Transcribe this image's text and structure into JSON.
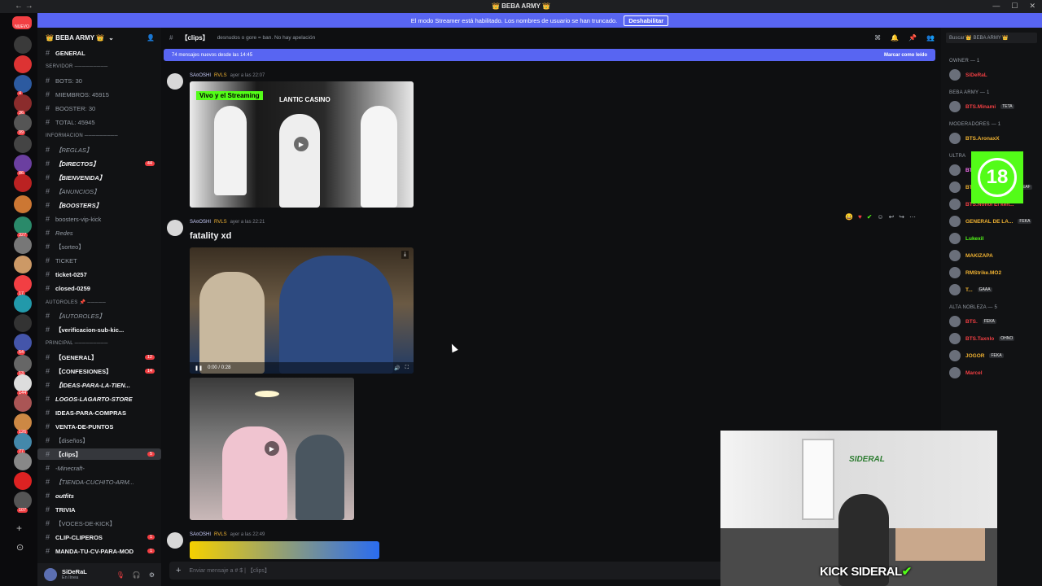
{
  "window": {
    "title": "👑 BEBA ARMY 👑",
    "controls": [
      "—",
      "☐",
      "✕"
    ]
  },
  "streamer_banner": {
    "text": "El modo Streamer está habilitado. Los nombres de usuario se han truncado.",
    "button": "Deshabilitar"
  },
  "server_badge_new": "NUEVO",
  "server_list": {
    "badges": [
      "4",
      "36",
      "99",
      "86",
      "327",
      "17",
      "54",
      "13",
      "144",
      "126",
      "77",
      "107"
    ]
  },
  "server": {
    "name": "👑 BEBA ARMY 👑"
  },
  "channels": [
    {
      "type": "channel",
      "label": "GENERAL",
      "strong": true
    },
    {
      "type": "category",
      "label": "SERVIDOR ─────────"
    },
    {
      "type": "channel",
      "label": "BOTS: 30"
    },
    {
      "type": "channel",
      "label": "MIEMBROS: 45915"
    },
    {
      "type": "channel",
      "label": "BOOSTER: 30"
    },
    {
      "type": "channel",
      "label": "TOTAL: 45945"
    },
    {
      "type": "category",
      "label": "INFORMACION ─────────"
    },
    {
      "type": "channel",
      "label": "【REGLAS】",
      "italic": true
    },
    {
      "type": "channel",
      "label": "【DIRECTOS】",
      "italic": true,
      "strong": true,
      "badge": "44"
    },
    {
      "type": "channel",
      "label": "【BIENVENIDA】",
      "italic": true,
      "strong": true
    },
    {
      "type": "channel",
      "label": "【ANUNCIOS】",
      "italic": true
    },
    {
      "type": "channel",
      "label": "【BOOSTERS】",
      "italic": true,
      "strong": true
    },
    {
      "type": "channel",
      "label": "boosters-vip-kick"
    },
    {
      "type": "channel",
      "label": "Redes",
      "italic": true
    },
    {
      "type": "channel",
      "label": "【sorteo】"
    },
    {
      "type": "channel",
      "label": "TICKET"
    },
    {
      "type": "channel",
      "label": "ticket-0257",
      "strong": true
    },
    {
      "type": "channel",
      "label": "closed-0259",
      "strong": true
    },
    {
      "type": "category",
      "label": "AUTOROLES 📌 ─────"
    },
    {
      "type": "channel",
      "label": "【AUTOROLES】",
      "italic": true
    },
    {
      "type": "channel",
      "label": "【verificacion-sub-kic...",
      "strong": true
    },
    {
      "type": "category",
      "label": "PRINCIPAL ─────────"
    },
    {
      "type": "channel",
      "label": "【GENERAL】",
      "strong": true,
      "badge": "12"
    },
    {
      "type": "channel",
      "label": "【CONFESIONES】",
      "strong": true,
      "badge": "14"
    },
    {
      "type": "channel",
      "label": "【IDEAS-PARA-LA-TIEN...",
      "italic": true,
      "strong": true
    },
    {
      "type": "channel",
      "label": "LOGOS-LAGARTO-STORE",
      "italic": true,
      "strong": true
    },
    {
      "type": "channel",
      "label": "IDEAS-PARA-COMPRAS",
      "strong": true
    },
    {
      "type": "channel",
      "label": "VENTA-DE-PUNTOS",
      "strong": true
    },
    {
      "type": "channel",
      "label": "【diseños】"
    },
    {
      "type": "channel",
      "label": "【clips】",
      "strong": true,
      "active": true,
      "badge": "5"
    },
    {
      "type": "channel",
      "label": "-Minecraft-",
      "italic": true
    },
    {
      "type": "channel",
      "label": "【TIENDA-CUCHITO-ARM...",
      "italic": true
    },
    {
      "type": "channel",
      "label": "outfits",
      "italic": true,
      "strong": true
    },
    {
      "type": "channel",
      "label": "TRIVIA",
      "strong": true
    },
    {
      "type": "channel",
      "label": "【VOCES-DE-KICK】"
    },
    {
      "type": "channel",
      "label": "CLIP-CLIPEROS",
      "strong": true,
      "badge": "1"
    },
    {
      "type": "channel",
      "label": "MANDA-TU-CV-PARA-MOD",
      "strong": true,
      "badge": "1"
    }
  ],
  "user_panel": {
    "name": "SiDeRaL",
    "status": "En línea"
  },
  "chat": {
    "channel": "【clips】",
    "topic": "desnudos o gore = ban. No hay apelación",
    "new_messages": "74 mensajes nuevos desde las 14:45",
    "mark_read": "Marcar como leído",
    "messages": [
      {
        "author": "SA¤OSHI",
        "tag": "RVLS",
        "time": "ayer a las 22:07",
        "thumb_title": "Vivo y el Streaming",
        "thumb_sub": "LANTIC CASINO"
      },
      {
        "author": "SA¤OSHI",
        "tag": "RVLS",
        "time": "ayer a las 22:21",
        "text": "fatality xd",
        "video_time": "0:00 / 0:28"
      },
      {
        "author": "SA¤OSHI",
        "tag": "RVLS",
        "time": "ayer a las 22:49"
      }
    ],
    "composer_placeholder": "Enviar mensaje a # $ | 【clips】"
  },
  "members": {
    "search_placeholder": "Buscar 👑 BEBA ARMY 👑",
    "groups": [
      {
        "label": "OWNER — 1",
        "list": [
          {
            "name": "SiDeRaL",
            "color": "#f23f43"
          }
        ]
      },
      {
        "label": "BEBA ARMY — 1",
        "list": [
          {
            "name": "BTS.Minami",
            "color": "#f23f43",
            "tag": "TETA"
          }
        ]
      },
      {
        "label": "MODERADORES — 1",
        "list": [
          {
            "name": "BTS.AronaxX",
            "color": "#f0b232"
          }
        ]
      },
      {
        "label": "ULTRA",
        "list": [
          {
            "name": "BTS.Cmg",
            "color": "#ff73fa",
            "tag": "Meow"
          },
          {
            "name": "BTS.Jack Campb...",
            "color": "#f0b232",
            "tag": "SEAF"
          },
          {
            "name": "BTS.Nohoi El keh...",
            "color": "#f23f43"
          },
          {
            "name": "GENERAL DE LA...",
            "color": "#f0b232",
            "tag": "FEKA"
          },
          {
            "name": "Lukexil",
            "color": "#53fc18"
          },
          {
            "name": "MAKIZAPA",
            "color": "#f0b232"
          },
          {
            "name": "RMStrike.MO2",
            "color": "#f0b232"
          },
          {
            "name": "T...",
            "color": "#f0b232",
            "tag": "GAAA"
          }
        ]
      },
      {
        "label": "ALTA NOBLEZA — 5",
        "list": [
          {
            "name": "BTS.",
            "color": "#f23f43",
            "tag": "FEKA"
          },
          {
            "name": "BTS.Taxnlo",
            "color": "#f23f43",
            "tag": "OHNO"
          },
          {
            "name": "JOGOR",
            "color": "#f0b232",
            "tag": "FEKA"
          },
          {
            "name": "Marcel",
            "color": "#f23f43"
          }
        ]
      }
    ]
  },
  "age_badge": "18",
  "webcam": {
    "logo_text": "SIDERAL",
    "label": "KICK SIDERAL"
  },
  "colors": {
    "accent": "#5865f2",
    "kick_green": "#53fc18",
    "danger": "#f23f43"
  }
}
